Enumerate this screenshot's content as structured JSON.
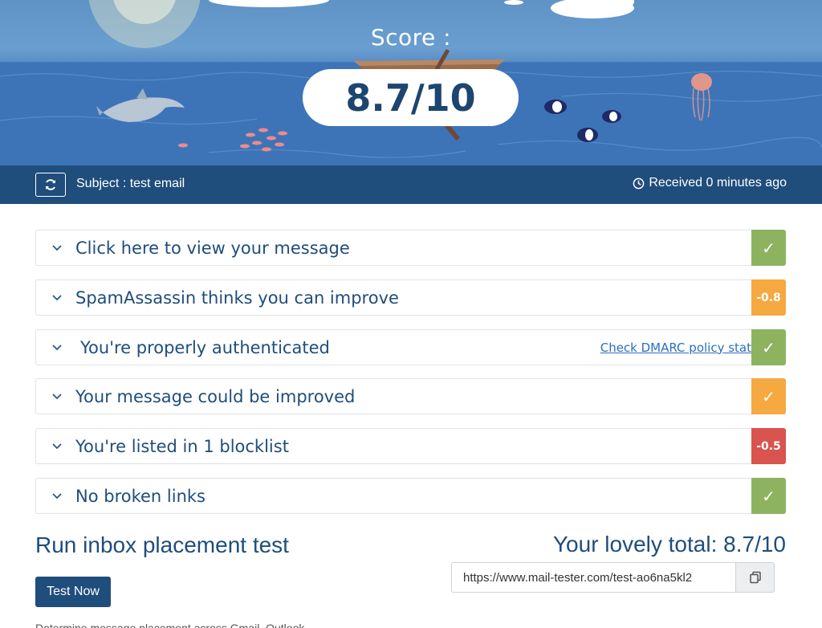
{
  "hero": {
    "score_label": "Score :",
    "score_value": "8.7/10"
  },
  "infobar": {
    "subject": "Subject : test email",
    "received": "Received 0 minutes ago"
  },
  "results": [
    {
      "label": "Click here to view your message",
      "status": "check",
      "badge": "✓",
      "color": "#8db361"
    },
    {
      "label": "SpamAssassin thinks you can improve",
      "status": "score",
      "badge": "-0.8",
      "color": "#f5a940"
    },
    {
      "label": "You're properly authenticated",
      "status": "check",
      "badge": "✓",
      "color": "#8db361",
      "link": "Check DMARC policy state ›"
    },
    {
      "label": "Your message could be improved",
      "status": "check",
      "badge": "✓",
      "color": "#f5a940"
    },
    {
      "label": "You're listed in 1 blocklist",
      "status": "score",
      "badge": "-0.5",
      "color": "#d9534f"
    },
    {
      "label": "No broken links",
      "status": "check",
      "badge": "✓",
      "color": "#8db361"
    }
  ],
  "inbox": {
    "title": "Run inbox placement test",
    "button": "Test Now",
    "description": "Determine message placement across Gmail, Outlook..."
  },
  "total": {
    "label": "Your lovely total: 8.7/10",
    "url": "https://www.mail-tester.com/test-ao6na5kl2"
  },
  "colors": {
    "primary": "#1f4d7c",
    "green": "#8db361",
    "orange": "#f5a940",
    "red": "#d9534f"
  }
}
